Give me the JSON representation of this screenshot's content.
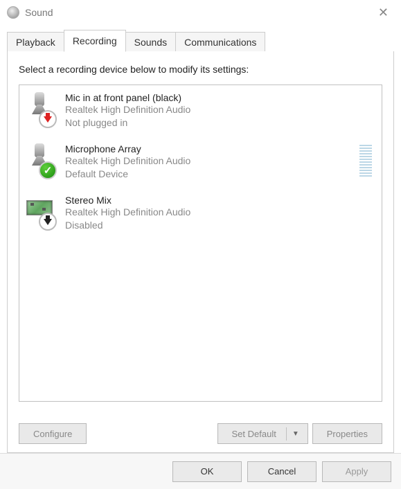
{
  "window": {
    "title": "Sound"
  },
  "tabs": [
    {
      "label": "Playback"
    },
    {
      "label": "Recording"
    },
    {
      "label": "Sounds"
    },
    {
      "label": "Communications"
    }
  ],
  "active_tab": 1,
  "instruction": "Select a recording device below to modify its settings:",
  "devices": [
    {
      "name": "Mic in at front panel (black)",
      "driver": "Realtek High Definition Audio",
      "status": "Not plugged in",
      "icon": "mic",
      "badge": "unplugged",
      "meter": false
    },
    {
      "name": "Microphone Array",
      "driver": "Realtek High Definition Audio",
      "status": "Default Device",
      "icon": "mic",
      "badge": "default",
      "meter": true
    },
    {
      "name": "Stereo Mix",
      "driver": "Realtek High Definition Audio",
      "status": "Disabled",
      "icon": "pcb",
      "badge": "disabled",
      "meter": false
    }
  ],
  "panel_buttons": {
    "configure": "Configure",
    "set_default": "Set Default",
    "properties": "Properties"
  },
  "dialog_buttons": {
    "ok": "OK",
    "cancel": "Cancel",
    "apply": "Apply"
  }
}
